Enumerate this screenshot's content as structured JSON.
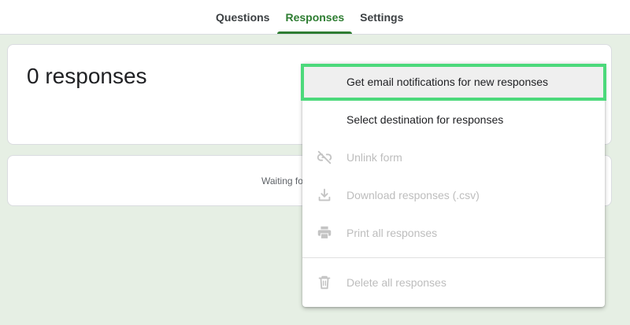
{
  "tabs": [
    {
      "label": "Questions",
      "active": false
    },
    {
      "label": "Responses",
      "active": true
    },
    {
      "label": "Settings",
      "active": false
    }
  ],
  "summary": {
    "count_text": "0 responses"
  },
  "waiting": {
    "text": "Waiting fo"
  },
  "menu": {
    "items": [
      {
        "label": "Get email notifications for new responses",
        "icon": "none",
        "disabled": false
      },
      {
        "label": "Select destination for responses",
        "icon": "none",
        "disabled": false
      },
      {
        "label": "Unlink form",
        "icon": "link-off-icon",
        "disabled": true
      },
      {
        "label": "Download responses (.csv)",
        "icon": "download-icon",
        "disabled": true
      },
      {
        "label": "Print all responses",
        "icon": "print-icon",
        "disabled": true
      },
      {
        "label": "Delete all responses",
        "icon": "trash-icon",
        "disabled": true
      }
    ]
  },
  "colors": {
    "accent": "#2e7d32",
    "background": "#e6efe4",
    "highlight_frame": "#4cd97b",
    "disabled_text": "#bdbdbd"
  }
}
